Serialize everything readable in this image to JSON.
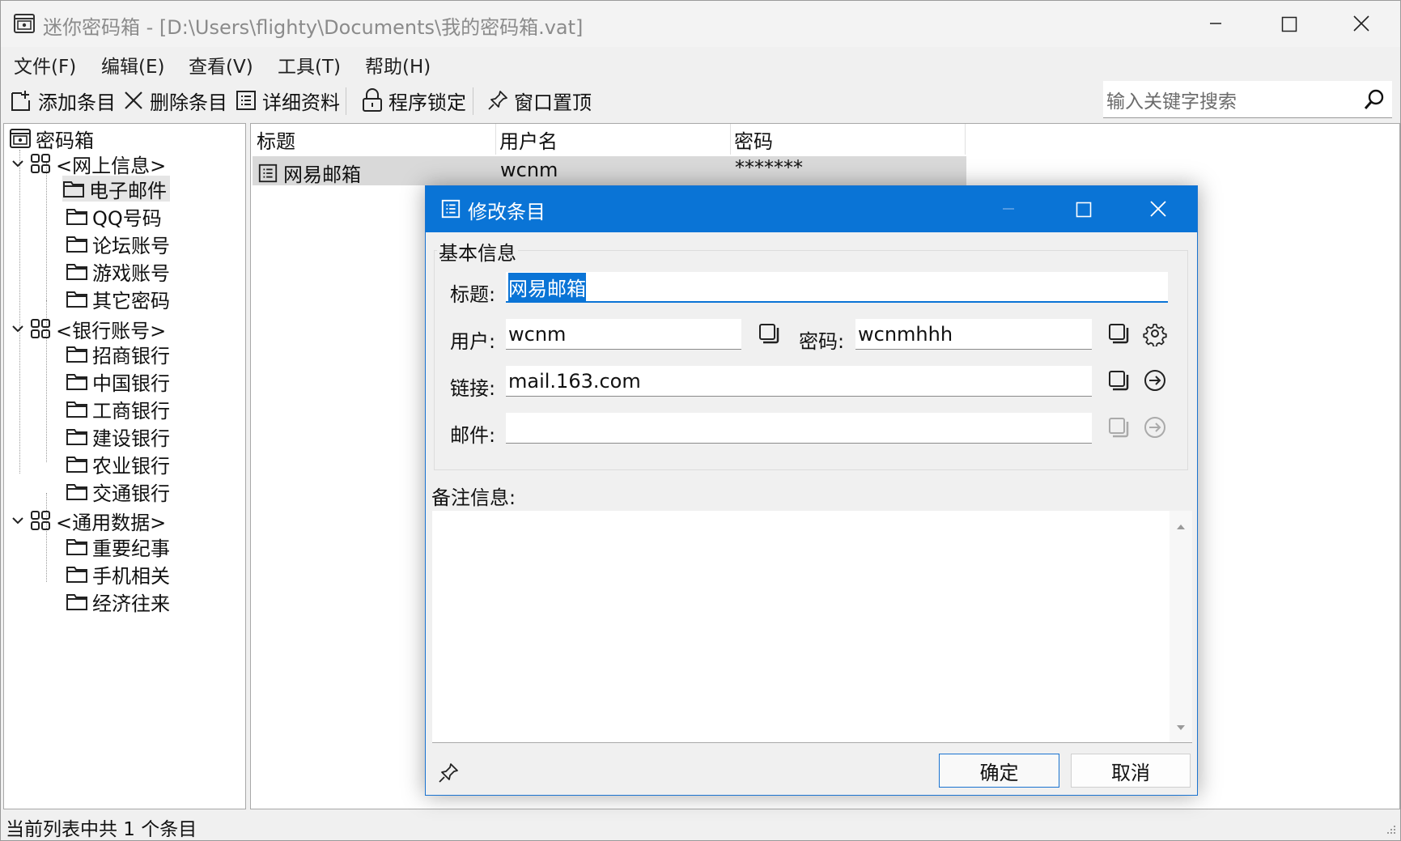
{
  "window": {
    "app_name": "迷你密码箱",
    "file_path": " - [D:\\Users\\flighty\\Documents\\我的密码箱.vat]"
  },
  "menu": [
    "文件(F)",
    "编辑(E)",
    "查看(V)",
    "工具(T)",
    "帮助(H)"
  ],
  "toolbar": {
    "add": "添加条目",
    "delete": "删除条目",
    "details": "详细资料",
    "lock": "程序锁定",
    "pin": "窗口置顶",
    "search_placeholder": "输入关键字搜索"
  },
  "tree": {
    "root": "密码箱",
    "groups": [
      {
        "label": "<网上信息>",
        "items": [
          "电子邮件",
          "QQ号码",
          "论坛账号",
          "游戏账号",
          "其它密码"
        ]
      },
      {
        "label": "<银行账号>",
        "items": [
          "招商银行",
          "中国银行",
          "工商银行",
          "建设银行",
          "农业银行",
          "交通银行"
        ]
      },
      {
        "label": "<通用数据>",
        "items": [
          "重要纪事",
          "手机相关",
          "经济往来"
        ]
      }
    ],
    "selected": "电子邮件"
  },
  "list": {
    "columns": [
      "标题",
      "用户名",
      "密码"
    ],
    "rows": [
      {
        "title": "网易邮箱",
        "user": "wcnm",
        "password": "*******"
      }
    ]
  },
  "status": "当前列表中共 1 个条目",
  "dialog": {
    "title": "修改条目",
    "group_label": "基本信息",
    "title_label": "标题:",
    "title_value": "网易邮箱",
    "user_label": "用户:",
    "user_value": "wcnm",
    "password_label": "密码:",
    "password_value": "wcnmhhh",
    "link_label": "链接:",
    "link_value": "mail.163.com",
    "mail_label": "邮件:",
    "mail_value": "",
    "notes_label": "备注信息:",
    "ok": "确定",
    "cancel": "取消"
  },
  "colors": {
    "accent": "#0a74d6"
  }
}
